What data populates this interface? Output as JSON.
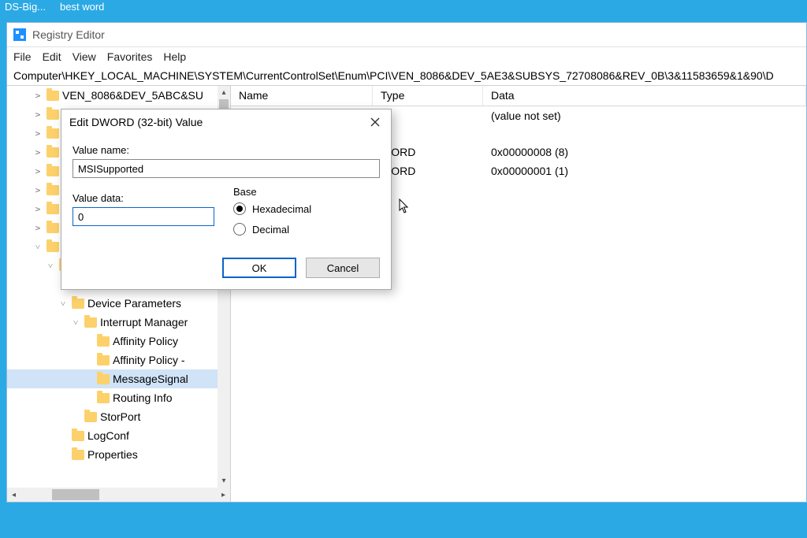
{
  "taskbar": {
    "items": [
      "DS-Big...",
      "best word"
    ]
  },
  "window": {
    "title": "Registry Editor",
    "menu": [
      "File",
      "Edit",
      "View",
      "Favorites",
      "Help"
    ],
    "address": "Computer\\HKEY_LOCAL_MACHINE\\SYSTEM\\CurrentControlSet\\Enum\\PCI\\VEN_8086&DEV_5AE3&SUBSYS_72708086&REV_0B\\3&11583659&1&90\\D"
  },
  "tree": {
    "rows": [
      {
        "indent": 1,
        "twisty": ">",
        "label": "VEN_8086&DEV_5ABC&SU"
      },
      {
        "indent": 1,
        "twisty": ">",
        "label": ""
      },
      {
        "indent": 1,
        "twisty": ">",
        "label": ""
      },
      {
        "indent": 1,
        "twisty": ">",
        "label": ""
      },
      {
        "indent": 1,
        "twisty": ">",
        "label": ""
      },
      {
        "indent": 1,
        "twisty": ">",
        "label": ""
      },
      {
        "indent": 1,
        "twisty": ">",
        "label": ""
      },
      {
        "indent": 1,
        "twisty": ">",
        "label": ""
      },
      {
        "indent": 1,
        "twisty": "v",
        "label": ""
      },
      {
        "indent": 2,
        "twisty": "v",
        "label": ""
      },
      {
        "indent": 3,
        "twisty": "",
        "label": ""
      },
      {
        "indent": 3,
        "twisty": "v",
        "label": "Device Parameters"
      },
      {
        "indent": 4,
        "twisty": "v",
        "label": "Interrupt Manager"
      },
      {
        "indent": 5,
        "twisty": "",
        "label": "Affinity Policy"
      },
      {
        "indent": 5,
        "twisty": "",
        "label": "Affinity Policy -"
      },
      {
        "indent": 5,
        "twisty": "",
        "label": "MessageSignal",
        "selected": true
      },
      {
        "indent": 5,
        "twisty": "",
        "label": "Routing Info"
      },
      {
        "indent": 4,
        "twisty": "",
        "label": "StorPort"
      },
      {
        "indent": 3,
        "twisty": "",
        "label": "LogConf"
      },
      {
        "indent": 3,
        "twisty": "",
        "label": "Properties"
      }
    ]
  },
  "list": {
    "headers": {
      "name": "Name",
      "type": "Type",
      "data": "Data"
    },
    "rows": [
      {
        "name": "",
        "type": "",
        "data": "(value not set)"
      },
      {
        "name": "",
        "type": "WORD",
        "data": "0x00000008 (8)"
      },
      {
        "name": "",
        "type": "WORD",
        "data": "0x00000001 (1)"
      }
    ]
  },
  "dialog": {
    "title": "Edit DWORD (32-bit) Value",
    "value_name_label": "Value name:",
    "value_name": "MSISupported",
    "value_data_label": "Value data:",
    "value_data": "0",
    "base_label": "Base",
    "radio_hex": "Hexadecimal",
    "radio_dec": "Decimal",
    "base_selected": "hex",
    "ok": "OK",
    "cancel": "Cancel"
  }
}
